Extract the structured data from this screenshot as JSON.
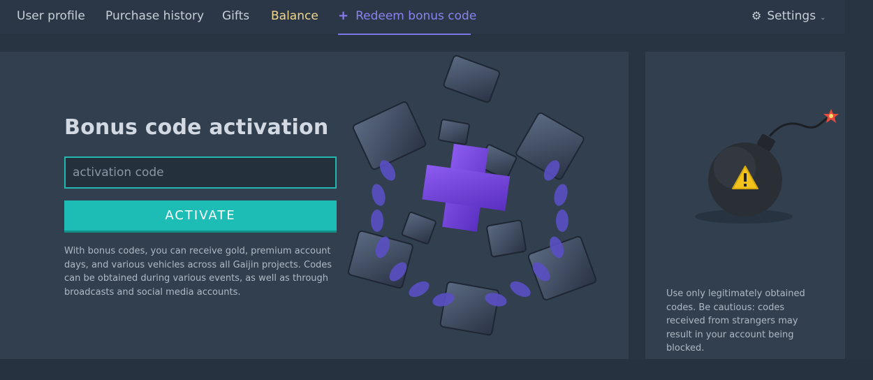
{
  "nav": {
    "items": [
      {
        "label": "User profile"
      },
      {
        "label": "Purchase history"
      },
      {
        "label": "Gifts"
      },
      {
        "label": "Balance"
      },
      {
        "label": "Redeem bonus code"
      }
    ],
    "settings_label": "Settings"
  },
  "bonus": {
    "title": "Bonus code activation",
    "input_placeholder": "activation code",
    "input_value": "",
    "activate_label": "ACTIVATE",
    "description": "With bonus codes, you can receive gold, premium account days, and various vehicles across all Gaijin projects. Codes can be obtained during various events, as well as through broadcasts and social media accounts."
  },
  "side": {
    "warning": "Use only legitimately obtained codes. Be cautious: codes received from strangers may result in your account being blocked."
  },
  "icons": {
    "plus": "plus-icon",
    "gear": "gear-icon",
    "chevron": "chevron-down-icon",
    "bomb": "bomb-illustration",
    "warning": "warning-icon"
  },
  "colors": {
    "accent_teal": "#1dbcb5",
    "active_tab": "#8a82f0",
    "balance": "#f1d78a",
    "panel_bg": "#313f4f"
  }
}
